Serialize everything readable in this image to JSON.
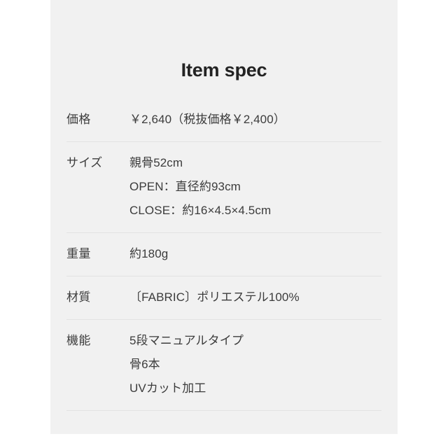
{
  "card": {
    "title": "Item spec",
    "rows": [
      {
        "label": "価格",
        "lines": [
          "￥2,640（税抜価格￥2,400）"
        ]
      },
      {
        "label": "サイズ",
        "lines": [
          "親骨52cm",
          "OPEN：直径約93cm",
          "CLOSE：約16×4.5×4.5cm"
        ]
      },
      {
        "label": "重量",
        "lines": [
          "約180g"
        ]
      },
      {
        "label": "材質",
        "lines": [
          "〔FABRIC〕ポリエステル100%"
        ]
      },
      {
        "label": "機能",
        "lines": [
          "5段マニュアルタイプ",
          "骨6本",
          "UVカット加工"
        ]
      }
    ]
  },
  "colors": {
    "page_background": "#ffffff",
    "card_background": "#f1f1f1",
    "text": "#3c3c3c",
    "title_text": "#232323",
    "divider": "#e2e2e2"
  }
}
